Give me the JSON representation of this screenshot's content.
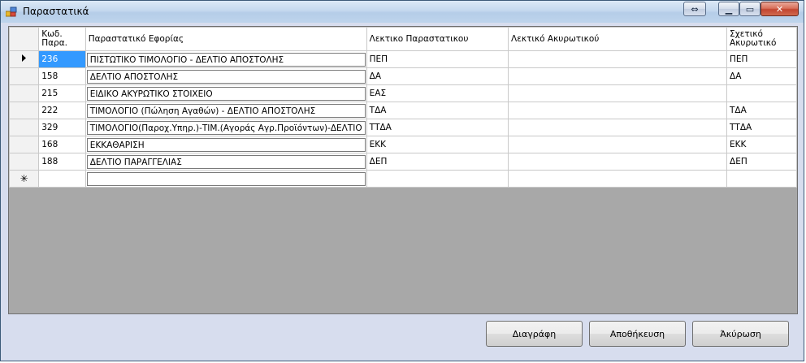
{
  "window": {
    "title": "Παραστατικά"
  },
  "grid": {
    "columns": [
      "Κωδ. Παρα.",
      "Παραστατικό Εφορίας",
      "Λεκτικο Παραστατικου",
      "Λεκτικό Ακυρωτικού",
      "Σχετικό Ακυρωτικό"
    ],
    "rows": [
      [
        "236",
        "ΠΙΣΤΩΤΙΚΟ ΤΙΜΟΛΟΓΙΟ - ΔΕΛΤΙΟ ΑΠΟΣΤΟΛΗΣ",
        "ΠΕΠ",
        "",
        "ΠΕΠ"
      ],
      [
        "158",
        "ΔΕΛΤΙΟ ΑΠΟΣΤΟΛΗΣ",
        "ΔΑ",
        "",
        "ΔΑ"
      ],
      [
        "215",
        "ΕΙΔΙΚΟ ΑΚΥΡΩΤΙΚΟ ΣΤΟΙΧΕΙΟ",
        "ΕΑΣ",
        "",
        ""
      ],
      [
        "222",
        "ΤΙΜΟΛΟΓΙΟ (Πώληση Αγαθών) - ΔΕΛΤΙΟ ΑΠΟΣΤΟΛΗΣ",
        "ΤΔΑ",
        "",
        "ΤΔΑ"
      ],
      [
        "329",
        "ΤΙΜΟΛΟΓΙΟ(Παροχ.Υπηρ.)-ΤΙΜ.(Αγοράς Αγρ.Προϊόντων)-ΔΕΛΤΙΟ",
        "ΤΤΔΑ",
        "",
        "ΤΤΔΑ"
      ],
      [
        "168",
        "ΕΚΚΑΘΑΡΙΣΗ",
        "ΕΚΚ",
        "",
        "ΕΚΚ"
      ],
      [
        "188",
        "ΔΕΛΤΙΟ ΠΑΡΑΓΓΕΛΙΑΣ",
        "ΔΕΠ",
        "",
        "ΔΕΠ"
      ]
    ],
    "current_row_icon": "row-pointer-icon",
    "new_row_icon": "new-row-asterisk-icon",
    "selected_color": "#3399ff"
  },
  "buttons": {
    "delete": "Διαγράφη",
    "save": "Αποθήκευση",
    "cancel": "Άκύρωση"
  },
  "colors": {
    "grid_background": "#a8a8a8",
    "form_background": "#d7ddee"
  }
}
